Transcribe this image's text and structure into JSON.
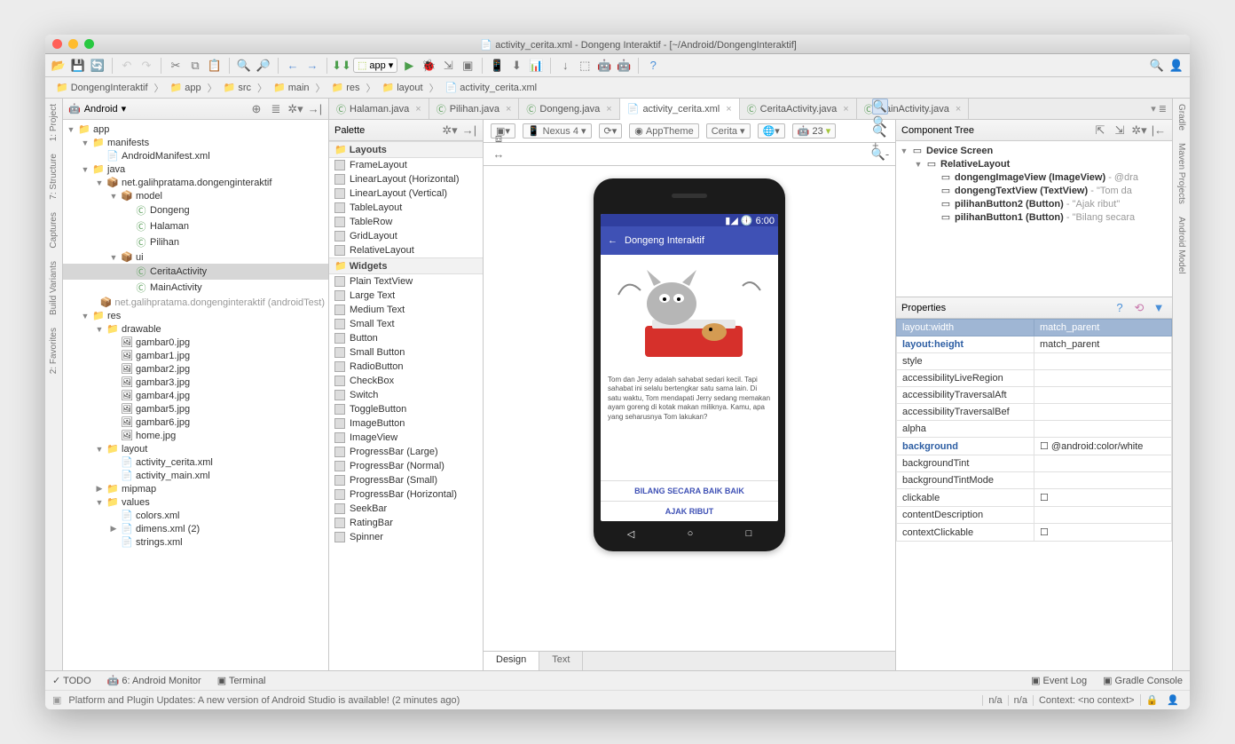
{
  "window": {
    "title": "activity_cerita.xml - Dongeng Interaktif - [~/Android/DongengInteraktif]"
  },
  "toolbar": {
    "run_config": "app"
  },
  "breadcrumb": [
    "DongengInteraktif",
    "app",
    "src",
    "main",
    "res",
    "layout",
    "activity_cerita.xml"
  ],
  "project": {
    "selector": "Android",
    "root": "app",
    "items": [
      {
        "d": 0,
        "arrow": "▼",
        "icon": "📁",
        "label": "app",
        "class": "mod"
      },
      {
        "d": 1,
        "arrow": "▼",
        "icon": "📁",
        "label": "manifests"
      },
      {
        "d": 2,
        "arrow": "",
        "icon": "📄",
        "label": "AndroidManifest.xml"
      },
      {
        "d": 1,
        "arrow": "▼",
        "icon": "📁",
        "label": "java"
      },
      {
        "d": 2,
        "arrow": "▼",
        "icon": "📦",
        "label": "net.galihpratama.dongenginteraktif"
      },
      {
        "d": 3,
        "arrow": "▼",
        "icon": "📦",
        "label": "model"
      },
      {
        "d": 4,
        "arrow": "",
        "icon": "Ⓒ",
        "label": "Dongeng"
      },
      {
        "d": 4,
        "arrow": "",
        "icon": "Ⓒ",
        "label": "Halaman"
      },
      {
        "d": 4,
        "arrow": "",
        "icon": "Ⓒ",
        "label": "Pilihan"
      },
      {
        "d": 3,
        "arrow": "▼",
        "icon": "📦",
        "label": "ui"
      },
      {
        "d": 4,
        "arrow": "",
        "icon": "Ⓒ",
        "label": "CeritaActivity",
        "sel": true
      },
      {
        "d": 4,
        "arrow": "",
        "icon": "Ⓒ",
        "label": "MainActivity"
      },
      {
        "d": 2,
        "arrow": "",
        "icon": "📦",
        "label": "net.galihpratama.dongenginteraktif (androidTest)",
        "dim": true
      },
      {
        "d": 1,
        "arrow": "▼",
        "icon": "📁",
        "label": "res"
      },
      {
        "d": 2,
        "arrow": "▼",
        "icon": "📁",
        "label": "drawable"
      },
      {
        "d": 3,
        "arrow": "",
        "icon": "🖼",
        "label": "gambar0.jpg"
      },
      {
        "d": 3,
        "arrow": "",
        "icon": "🖼",
        "label": "gambar1.jpg"
      },
      {
        "d": 3,
        "arrow": "",
        "icon": "🖼",
        "label": "gambar2.jpg"
      },
      {
        "d": 3,
        "arrow": "",
        "icon": "🖼",
        "label": "gambar3.jpg"
      },
      {
        "d": 3,
        "arrow": "",
        "icon": "🖼",
        "label": "gambar4.jpg"
      },
      {
        "d": 3,
        "arrow": "",
        "icon": "🖼",
        "label": "gambar5.jpg"
      },
      {
        "d": 3,
        "arrow": "",
        "icon": "🖼",
        "label": "gambar6.jpg"
      },
      {
        "d": 3,
        "arrow": "",
        "icon": "🖼",
        "label": "home.jpg"
      },
      {
        "d": 2,
        "arrow": "▼",
        "icon": "📁",
        "label": "layout"
      },
      {
        "d": 3,
        "arrow": "",
        "icon": "📄",
        "label": "activity_cerita.xml"
      },
      {
        "d": 3,
        "arrow": "",
        "icon": "📄",
        "label": "activity_main.xml"
      },
      {
        "d": 2,
        "arrow": "▶",
        "icon": "📁",
        "label": "mipmap"
      },
      {
        "d": 2,
        "arrow": "▼",
        "icon": "📁",
        "label": "values"
      },
      {
        "d": 3,
        "arrow": "",
        "icon": "📄",
        "label": "colors.xml"
      },
      {
        "d": 3,
        "arrow": "▶",
        "icon": "📄",
        "label": "dimens.xml (2)"
      },
      {
        "d": 3,
        "arrow": "",
        "icon": "📄",
        "label": "strings.xml"
      }
    ]
  },
  "tabs": [
    {
      "icon": "Ⓒ",
      "label": "Halaman.java"
    },
    {
      "icon": "Ⓒ",
      "label": "Pilihan.java"
    },
    {
      "icon": "Ⓒ",
      "label": "Dongeng.java"
    },
    {
      "icon": "📄",
      "label": "activity_cerita.xml",
      "active": true
    },
    {
      "icon": "Ⓒ",
      "label": "CeritaActivity.java"
    },
    {
      "icon": "Ⓒ",
      "label": "MainActivity.java"
    }
  ],
  "palette": {
    "title": "Palette",
    "groups": [
      {
        "name": "Layouts",
        "items": [
          "FrameLayout",
          "LinearLayout (Horizontal)",
          "LinearLayout (Vertical)",
          "TableLayout",
          "TableRow",
          "GridLayout",
          "RelativeLayout"
        ]
      },
      {
        "name": "Widgets",
        "items": [
          "Plain TextView",
          "Large Text",
          "Medium Text",
          "Small Text",
          "Button",
          "Small Button",
          "RadioButton",
          "CheckBox",
          "Switch",
          "ToggleButton",
          "ImageButton",
          "ImageView",
          "ProgressBar (Large)",
          "ProgressBar (Normal)",
          "ProgressBar (Small)",
          "ProgressBar (Horizontal)",
          "SeekBar",
          "RatingBar",
          "Spinner"
        ]
      }
    ]
  },
  "design_toolbar": {
    "device": "Nexus 4",
    "theme": "AppTheme",
    "context": "Cerita",
    "api": "23"
  },
  "preview": {
    "clock": "6:00",
    "title": "Dongeng Interaktif",
    "story": "Tom dan Jerry adalah sahabat sedari kecil. Tapi sahabat ini selalu bertengkar satu sama lain. Di satu waktu, Tom mendapati Jerry sedang memakan ayam goreng di kotak makan miliknya. Kamu, apa yang seharusnya Tom lakukan?",
    "btn1": "BILANG SECARA BAIK BAIK",
    "btn2": "AJAK RIBUT"
  },
  "component_tree": {
    "title": "Component Tree",
    "items": [
      {
        "d": 0,
        "arrow": "▼",
        "label": "Device Screen"
      },
      {
        "d": 1,
        "arrow": "▼",
        "label": "RelativeLayout"
      },
      {
        "d": 2,
        "arrow": "",
        "label": "dongengImageView (ImageView) - @dra"
      },
      {
        "d": 2,
        "arrow": "",
        "label": "dongengTextView (TextView) - \"Tom da"
      },
      {
        "d": 2,
        "arrow": "",
        "label": "pilihanButton2 (Button) - \"Ajak ribut\""
      },
      {
        "d": 2,
        "arrow": "",
        "label": "pilihanButton1 (Button) - \"Bilang secara"
      }
    ]
  },
  "properties": {
    "title": "Properties",
    "rows": [
      {
        "k": "layout:width",
        "v": "match_parent",
        "hdr": true
      },
      {
        "k": "layout:height",
        "v": "match_parent",
        "bold": true
      },
      {
        "k": "style",
        "v": ""
      },
      {
        "k": "accessibilityLiveRegion",
        "v": ""
      },
      {
        "k": "accessibilityTraversalAft",
        "v": ""
      },
      {
        "k": "accessibilityTraversalBef",
        "v": ""
      },
      {
        "k": "alpha",
        "v": ""
      },
      {
        "k": "background",
        "v": "☐ @android:color/white",
        "bold": true
      },
      {
        "k": "backgroundTint",
        "v": ""
      },
      {
        "k": "backgroundTintMode",
        "v": ""
      },
      {
        "k": "clickable",
        "v": "☐"
      },
      {
        "k": "contentDescription",
        "v": ""
      },
      {
        "k": "contextClickable",
        "v": "☐"
      }
    ]
  },
  "bottom_tabs": {
    "design": "Design",
    "text": "Text"
  },
  "bottom_bar": [
    "TODO",
    "6: Android Monitor",
    "Terminal",
    "Event Log",
    "Gradle Console"
  ],
  "status": {
    "msg": "Platform and Plugin Updates: A new version of Android Studio is available! (2 minutes ago)",
    "pos1": "n/a",
    "pos2": "n/a",
    "ctx": "Context: <no context>"
  },
  "edges": {
    "left": [
      "1: Project",
      "7: Structure",
      "Captures",
      "Build Variants",
      "2: Favorites"
    ],
    "right": [
      "Gradle",
      "Maven Projects",
      "Android Model"
    ]
  }
}
